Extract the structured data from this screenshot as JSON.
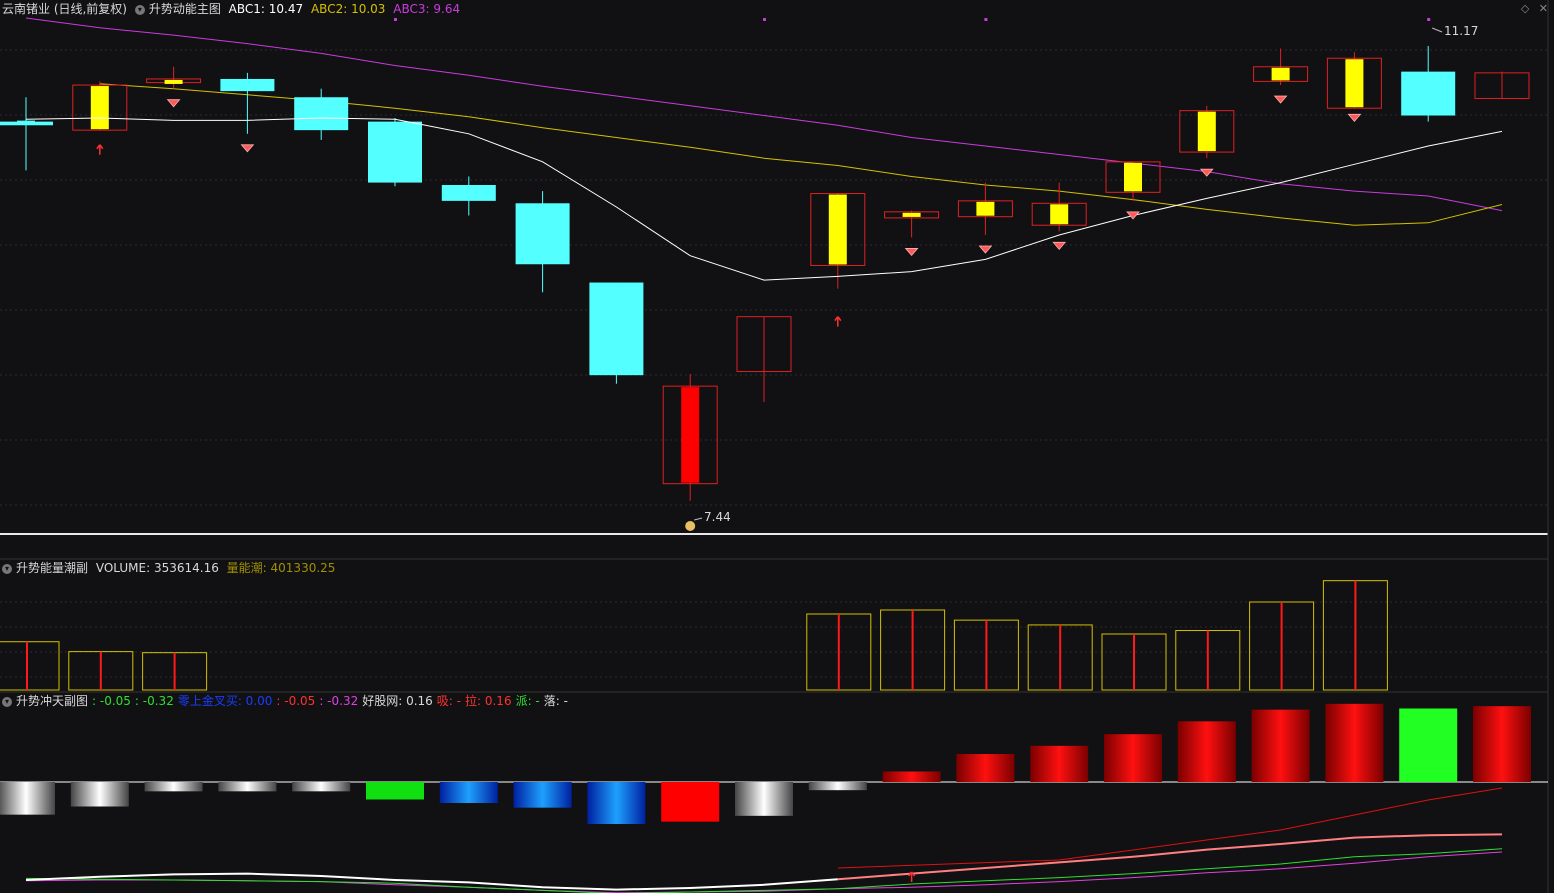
{
  "main_panel": {
    "stock_title": "云南锗业 (日线,前复权)",
    "indicator_name": "升势动能主图",
    "abc1_label": "ABC1: 10.47",
    "abc2_label": "ABC2: 10.03",
    "abc3_label": "ABC3: 9.64",
    "high_label": "11.17",
    "low_label": "7.44",
    "colors": {
      "abc1": "#ffffff",
      "abc2": "#d4c000",
      "abc3": "#c83cdc",
      "up_border": "#e02020",
      "down_fill": "#54ffff",
      "yellow_body": "#ffff00",
      "red_body": "#ff0000"
    }
  },
  "volume_panel": {
    "indicator_name": "升势能量潮副",
    "volume_label": "VOLUME: 353614.16",
    "obv_label": "量能潮: 401330.25"
  },
  "sub_panel": {
    "indicator_name": "升势冲天副图",
    "values": [
      {
        "text": ": -0.05",
        "color": "#2ee02e"
      },
      {
        "text": ": -0.32",
        "color": "#2ee02e"
      },
      {
        "text": "零上金叉买: 0.00",
        "color": "#1a3cff"
      },
      {
        "text": ": -0.05",
        "color": "#ff3030"
      },
      {
        "text": ": -0.32",
        "color": "#e040e0"
      },
      {
        "text": "好股网: 0.16",
        "color": "#d8d8d8"
      },
      {
        "text": "吸: -",
        "color": "#ff3030"
      },
      {
        "text": "拉: 0.16",
        "color": "#ff3030"
      },
      {
        "text": "派: -",
        "color": "#2ee02e"
      },
      {
        "text": "落: -",
        "color": "#d8d8d8"
      }
    ]
  },
  "toolbar": {
    "diamond_icon": "◇",
    "close_icon": "✕"
  },
  "chart_data": [
    {
      "type": "candlestick",
      "title": "云南锗业 (日线,前复权)",
      "ylim": [
        7.2,
        11.4
      ],
      "candles": [
        {
          "o": 10.55,
          "h": 10.75,
          "l": 10.15,
          "c": 10.52
        },
        {
          "o": 10.48,
          "h": 10.88,
          "l": 10.59,
          "c": 10.85
        },
        {
          "o": 10.87,
          "h": 11.0,
          "l": 10.82,
          "c": 10.9
        },
        {
          "o": 10.9,
          "h": 10.95,
          "l": 10.45,
          "c": 10.8
        },
        {
          "o": 10.75,
          "h": 10.82,
          "l": 10.4,
          "c": 10.48
        },
        {
          "o": 10.55,
          "h": 10.58,
          "l": 10.02,
          "c": 10.05
        },
        {
          "o": 10.03,
          "h": 10.1,
          "l": 9.78,
          "c": 9.9
        },
        {
          "o": 9.88,
          "h": 9.98,
          "l": 9.15,
          "c": 9.38
        },
        {
          "o": 9.23,
          "h": 9.23,
          "l": 8.4,
          "c": 8.47
        },
        {
          "o": 7.58,
          "h": 8.48,
          "l": 7.44,
          "c": 8.38
        },
        {
          "o": 8.5,
          "h": 8.85,
          "l": 8.25,
          "c": 8.95
        },
        {
          "o": 9.37,
          "h": 9.52,
          "l": 9.18,
          "c": 9.96
        },
        {
          "o": 9.76,
          "h": 9.82,
          "l": 9.6,
          "c": 9.81
        },
        {
          "o": 9.77,
          "h": 10.05,
          "l": 9.62,
          "c": 9.9
        },
        {
          "o": 9.7,
          "h": 10.05,
          "l": 9.65,
          "c": 9.88
        },
        {
          "o": 9.97,
          "h": 10.2,
          "l": 9.9,
          "c": 10.22
        },
        {
          "o": 10.3,
          "h": 10.68,
          "l": 10.25,
          "c": 10.64
        },
        {
          "o": 10.88,
          "h": 11.15,
          "l": 10.85,
          "c": 11.0
        },
        {
          "o": 10.66,
          "h": 11.12,
          "l": 10.7,
          "c": 11.07
        },
        {
          "o": 10.96,
          "h": 11.17,
          "l": 10.55,
          "c": 10.6
        },
        {
          "o": 10.74,
          "h": 10.96,
          "l": 10.75,
          "c": 10.95
        }
      ],
      "series": [
        {
          "name": "ABC1",
          "values": [
            10.57,
            10.58,
            10.56,
            10.56,
            10.58,
            10.57,
            10.45,
            10.22,
            9.85,
            9.45,
            9.25,
            9.28,
            9.32,
            9.42,
            9.62,
            9.78,
            9.92,
            10.05,
            10.2,
            10.35,
            10.47
          ]
        },
        {
          "name": "ABC2",
          "values": [
            null,
            10.86,
            10.82,
            10.77,
            10.72,
            10.66,
            10.59,
            10.5,
            10.42,
            10.34,
            10.25,
            10.19,
            10.1,
            10.03,
            9.98,
            9.91,
            9.83,
            9.76,
            9.7,
            9.72,
            9.87
          ]
        },
        {
          "name": "ABC3",
          "values": [
            11.4,
            11.32,
            11.26,
            11.19,
            11.11,
            11.01,
            10.93,
            10.84,
            10.76,
            10.68,
            10.6,
            10.52,
            10.42,
            10.35,
            10.28,
            10.21,
            10.14,
            10.04,
            9.98,
            9.94,
            9.82
          ]
        }
      ]
    },
    {
      "type": "bar",
      "title": "升势能量潮副",
      "ylim": [
        0,
        420000
      ],
      "values": [
        181000,
        144000,
        140000,
        null,
        null,
        null,
        null,
        null,
        null,
        null,
        null,
        285000,
        300000,
        262000,
        244000,
        210000,
        223000,
        330000,
        410000,
        null,
        null
      ]
    },
    {
      "type": "bar",
      "title": "升势冲天副图",
      "ylim": [
        -0.35,
        0.6
      ],
      "values": [
        -0.28,
        -0.21,
        -0.08,
        -0.08,
        -0.08,
        -0.15,
        -0.18,
        -0.22,
        -0.36,
        -0.34,
        -0.29,
        -0.07,
        0.09,
        0.24,
        0.31,
        0.41,
        0.52,
        0.62,
        0.67,
        0.63,
        0.65
      ],
      "series": [
        {
          "name": "white_red",
          "values": [
            -0.25,
            -0.21,
            -0.18,
            -0.17,
            -0.2,
            -0.25,
            -0.28,
            -0.34,
            -0.37,
            -0.35,
            -0.31,
            -0.24,
            -0.17,
            -0.1,
            -0.03,
            0.04,
            0.13,
            0.2,
            0.28,
            0.31,
            0.32
          ]
        },
        {
          "name": "green",
          "values": [
            -0.23,
            -0.24,
            -0.25,
            -0.26,
            -0.27,
            -0.29,
            -0.34,
            -0.38,
            -0.42,
            -0.4,
            -0.38,
            -0.36,
            -0.3,
            -0.26,
            -0.22,
            -0.17,
            -0.11,
            -0.05,
            0.04,
            0.08,
            0.14
          ]
        },
        {
          "name": "magenta",
          "values": [
            -0.26,
            -0.25,
            -0.25,
            -0.26,
            -0.27,
            -0.31,
            -0.34,
            -0.38,
            -0.41,
            -0.4,
            -0.39,
            -0.36,
            -0.34,
            -0.31,
            -0.27,
            -0.22,
            -0.16,
            -0.11,
            -0.04,
            0.04,
            0.1
          ]
        }
      ]
    }
  ]
}
